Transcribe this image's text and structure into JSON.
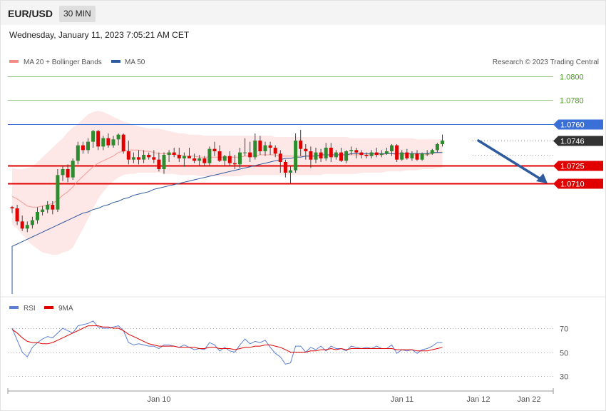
{
  "header": {
    "symbol": "EUR/USD",
    "timeframe": "30 MIN",
    "datetime": "Wednesday, January 11, 2023 7:05:21 AM CET"
  },
  "legend_main": [
    {
      "name": "MA 20 + Bollinger Bands",
      "color": "#f28b82"
    },
    {
      "name": "MA 50",
      "color": "#2e5a9e"
    }
  ],
  "credit": "Research © 2023 Trading Central",
  "legend_rsi": [
    {
      "name": "RSI",
      "color": "#5b7fd6"
    },
    {
      "name": "9MA",
      "color": "#e00000"
    }
  ],
  "colors": {
    "bull": "#2e8b2e",
    "bear": "#e00000",
    "resistance": "#3a6fd8",
    "support": "#e00000",
    "target": "#93c47d",
    "last": "#333333",
    "arrow": "#2e5a9e"
  },
  "chart_data": [
    {
      "type": "candlestick",
      "title": "EUR/USD",
      "ylim": [
        1.0665,
        1.0812
      ],
      "x_labels": [
        "Jan 10",
        "Jan 11",
        "Jan 12",
        "Jan 22"
      ],
      "price_levels": [
        {
          "value": 1.08,
          "label": "1.0800",
          "kind": "target"
        },
        {
          "value": 1.078,
          "label": "1.0780",
          "kind": "target"
        },
        {
          "value": 1.076,
          "label": "1.0760",
          "kind": "resistance"
        },
        {
          "value": 1.0746,
          "label": "1.0746",
          "kind": "last"
        },
        {
          "value": 1.0725,
          "label": "1.0725",
          "kind": "support"
        },
        {
          "value": 1.071,
          "label": "1.0710",
          "kind": "support"
        }
      ],
      "forecast_arrow": {
        "from": 1.0746,
        "to": 1.071
      },
      "candles": [
        [
          1.069,
          1.0691,
          1.0685,
          1.0689
        ],
        [
          1.0689,
          1.0692,
          1.0675,
          1.0678
        ],
        [
          1.0678,
          1.0683,
          1.067,
          1.0672
        ],
        [
          1.0672,
          1.0678,
          1.0669,
          1.0675
        ],
        [
          1.0675,
          1.0682,
          1.0672,
          1.0679
        ],
        [
          1.0679,
          1.069,
          1.0676,
          1.0686
        ],
        [
          1.0686,
          1.0691,
          1.0683,
          1.0688
        ],
        [
          1.0688,
          1.0695,
          1.0685,
          1.0692
        ],
        [
          1.0692,
          1.0695,
          1.0684,
          1.0688
        ],
        [
          1.0688,
          1.0722,
          1.0686,
          1.0717
        ],
        [
          1.0717,
          1.0725,
          1.0712,
          1.0722
        ],
        [
          1.0722,
          1.0726,
          1.0711,
          1.0715
        ],
        [
          1.0715,
          1.0731,
          1.0713,
          1.0729
        ],
        [
          1.0729,
          1.0745,
          1.0726,
          1.0742
        ],
        [
          1.0742,
          1.0745,
          1.0735,
          1.0738
        ],
        [
          1.0738,
          1.0748,
          1.0735,
          1.0745
        ],
        [
          1.0745,
          1.0755,
          1.074,
          1.0754
        ],
        [
          1.0754,
          1.0755,
          1.0738,
          1.0741
        ],
        [
          1.0741,
          1.075,
          1.0738,
          1.0748
        ],
        [
          1.0748,
          1.0752,
          1.074,
          1.0742
        ],
        [
          1.0742,
          1.075,
          1.074,
          1.0747
        ],
        [
          1.0747,
          1.0752,
          1.0742,
          1.0751
        ],
        [
          1.0751,
          1.0752,
          1.0735,
          1.0737
        ],
        [
          1.0737,
          1.0746,
          1.0726,
          1.073
        ],
        [
          1.073,
          1.0736,
          1.0727,
          1.0732
        ],
        [
          1.0732,
          1.0738,
          1.0726,
          1.073
        ],
        [
          1.073,
          1.0738,
          1.0727,
          1.0734
        ],
        [
          1.0734,
          1.0736,
          1.073,
          1.0732
        ],
        [
          1.0732,
          1.0738,
          1.0727,
          1.073
        ],
        [
          1.073,
          1.0736,
          1.072,
          1.0722
        ],
        [
          1.0722,
          1.0736,
          1.0718,
          1.0734
        ],
        [
          1.0734,
          1.0738,
          1.0728,
          1.0736
        ],
        [
          1.0736,
          1.074,
          1.0732,
          1.0734
        ],
        [
          1.0734,
          1.074,
          1.0728,
          1.0731
        ],
        [
          1.0731,
          1.0736,
          1.0724,
          1.0733
        ],
        [
          1.0733,
          1.074,
          1.0731,
          1.0731
        ],
        [
          1.0731,
          1.0735,
          1.0727,
          1.0729
        ],
        [
          1.0729,
          1.0734,
          1.0725,
          1.0731
        ],
        [
          1.0731,
          1.0733,
          1.0725,
          1.0727
        ],
        [
          1.0727,
          1.0741,
          1.0725,
          1.0739
        ],
        [
          1.0739,
          1.0745,
          1.0733,
          1.0737
        ],
        [
          1.0737,
          1.0742,
          1.0728,
          1.0729
        ],
        [
          1.0729,
          1.0734,
          1.0725,
          1.0733
        ],
        [
          1.0733,
          1.0737,
          1.0725,
          1.0727
        ],
        [
          1.0727,
          1.0734,
          1.0722,
          1.0726
        ],
        [
          1.0726,
          1.074,
          1.0723,
          1.0736
        ],
        [
          1.0736,
          1.0748,
          1.0733,
          1.0736
        ],
        [
          1.0736,
          1.0745,
          1.0728,
          1.0732
        ],
        [
          1.0732,
          1.0752,
          1.073,
          1.0746
        ],
        [
          1.0746,
          1.075,
          1.0734,
          1.0737
        ],
        [
          1.0737,
          1.0745,
          1.0733,
          1.0742
        ],
        [
          1.0742,
          1.0745,
          1.0734,
          1.074
        ],
        [
          1.074,
          1.0742,
          1.0732,
          1.0735
        ],
        [
          1.0735,
          1.0738,
          1.0719,
          1.0728
        ],
        [
          1.0728,
          1.073,
          1.0715,
          1.0719
        ],
        [
          1.0719,
          1.0725,
          1.071,
          1.0721
        ],
        [
          1.0721,
          1.0752,
          1.0719,
          1.0746
        ],
        [
          1.0746,
          1.0755,
          1.0733,
          1.0739
        ],
        [
          1.0739,
          1.0743,
          1.073,
          1.0737
        ],
        [
          1.0737,
          1.0741,
          1.0723,
          1.073
        ],
        [
          1.073,
          1.074,
          1.0727,
          1.0736
        ],
        [
          1.0736,
          1.0739,
          1.0728,
          1.0731
        ],
        [
          1.0731,
          1.0744,
          1.0729,
          1.074
        ],
        [
          1.074,
          1.0744,
          1.0728,
          1.0732
        ],
        [
          1.0732,
          1.0738,
          1.073,
          1.0736
        ],
        [
          1.0736,
          1.074,
          1.0728,
          1.0729
        ],
        [
          1.0729,
          1.0738,
          1.0727,
          1.0737
        ],
        [
          1.0737,
          1.0741,
          1.0734,
          1.0738
        ],
        [
          1.0738,
          1.074,
          1.0731,
          1.0736
        ],
        [
          1.0736,
          1.0738,
          1.0731,
          1.0734
        ],
        [
          1.0734,
          1.0736,
          1.0731,
          1.0733
        ],
        [
          1.0733,
          1.0738,
          1.0731,
          1.0736
        ],
        [
          1.0736,
          1.074,
          1.0732,
          1.0734
        ],
        [
          1.0734,
          1.0738,
          1.0732,
          1.0735
        ],
        [
          1.0735,
          1.074,
          1.0734,
          1.0737
        ],
        [
          1.0737,
          1.0743,
          1.0733,
          1.0742
        ],
        [
          1.0742,
          1.0743,
          1.0728,
          1.073
        ],
        [
          1.073,
          1.0738,
          1.0729,
          1.0736
        ],
        [
          1.0736,
          1.0739,
          1.073,
          1.0731
        ],
        [
          1.0731,
          1.0737,
          1.0729,
          1.0735
        ],
        [
          1.0735,
          1.0738,
          1.0729,
          1.073
        ],
        [
          1.073,
          1.0736,
          1.0729,
          1.0735
        ],
        [
          1.0735,
          1.0738,
          1.0733,
          1.0735
        ],
        [
          1.0735,
          1.0739,
          1.0734,
          1.0738
        ],
        [
          1.0738,
          1.0744,
          1.0736,
          1.0743
        ],
        [
          1.0743,
          1.0751,
          1.0741,
          1.0746
        ]
      ],
      "ma20": [
        1.0699,
        1.0697,
        1.0694,
        1.0691,
        1.069,
        1.069,
        1.0691,
        1.0692,
        1.0693,
        1.0696,
        1.07,
        1.0703,
        1.0707,
        1.0712,
        1.0716,
        1.072,
        1.0724,
        1.0727,
        1.0729,
        1.0731,
        1.0733,
        1.0736,
        1.0737,
        1.0738,
        1.0738,
        1.0738,
        1.0737,
        1.0737,
        1.0736,
        1.0735,
        1.0735,
        1.0735,
        1.0734,
        1.0734,
        1.0733,
        1.0733,
        1.0733,
        1.0732,
        1.0732,
        1.0732,
        1.0732,
        1.0732,
        1.0732,
        1.0732,
        1.0732,
        1.0732,
        1.0733,
        1.0733,
        1.0733,
        1.0734,
        1.0734,
        1.0734,
        1.0734,
        1.0733,
        1.0733,
        1.0733,
        1.0733,
        1.0733,
        1.0733,
        1.0733,
        1.0733,
        1.0734,
        1.0734,
        1.0734,
        1.0734,
        1.0734,
        1.0734,
        1.0734,
        1.0734,
        1.0734,
        1.0734,
        1.0734,
        1.0734,
        1.0734,
        1.0735,
        1.0735,
        1.0734,
        1.0734,
        1.0734,
        1.0734,
        1.0734,
        1.0734,
        1.0734,
        1.0735,
        1.0736,
        1.0736
      ],
      "bb_upper": [
        1.0723,
        1.0722,
        1.0722,
        1.0723,
        1.0724,
        1.0728,
        1.0732,
        1.0736,
        1.074,
        1.0744,
        1.0748,
        1.0753,
        1.0757,
        1.076,
        1.0764,
        1.0768,
        1.077,
        1.0771,
        1.077,
        1.0768,
        1.0766,
        1.0764,
        1.0762,
        1.0761,
        1.0759,
        1.0758,
        1.0757,
        1.0756,
        1.0756,
        1.0756,
        1.0755,
        1.0754,
        1.0753,
        1.0752,
        1.0752,
        1.0751,
        1.0751,
        1.0751,
        1.075,
        1.075,
        1.075,
        1.075,
        1.075,
        1.075,
        1.075,
        1.075,
        1.075,
        1.075,
        1.075,
        1.075,
        1.075,
        1.075,
        1.0749,
        1.0749,
        1.0749,
        1.0749,
        1.0749,
        1.0749,
        1.0749,
        1.0749,
        1.0749,
        1.0749,
        1.0749,
        1.0749,
        1.0749,
        1.0749,
        1.0749,
        1.0748,
        1.0748,
        1.0748,
        1.0748,
        1.0748,
        1.0748,
        1.0748,
        1.0748,
        1.0748,
        1.0748,
        1.0748,
        1.0748,
        1.0748,
        1.0747,
        1.0747,
        1.0747,
        1.0747,
        1.0747,
        1.0747
      ],
      "bb_lower": [
        1.0675,
        1.0672,
        1.0667,
        1.0662,
        1.0658,
        1.0655,
        1.0652,
        1.0651,
        1.065,
        1.065,
        1.0652,
        1.0653,
        1.0656,
        1.0664,
        1.0672,
        1.068,
        1.0689,
        1.0697,
        1.0703,
        1.0708,
        1.0712,
        1.0715,
        1.0717,
        1.0718,
        1.0718,
        1.0719,
        1.0719,
        1.0719,
        1.0719,
        1.0719,
        1.0718,
        1.0718,
        1.0718,
        1.0717,
        1.0717,
        1.0717,
        1.0717,
        1.0716,
        1.0716,
        1.0716,
        1.0716,
        1.0716,
        1.0716,
        1.0716,
        1.0716,
        1.0716,
        1.0717,
        1.0717,
        1.0717,
        1.0717,
        1.0717,
        1.0717,
        1.0717,
        1.0717,
        1.0717,
        1.0717,
        1.0717,
        1.0717,
        1.0717,
        1.0717,
        1.0717,
        1.0717,
        1.0718,
        1.0718,
        1.0718,
        1.0718,
        1.0718,
        1.0718,
        1.0718,
        1.0719,
        1.0719,
        1.0719,
        1.0719,
        1.0719,
        1.072,
        1.072,
        1.072,
        1.072,
        1.0721,
        1.0721,
        1.0721,
        1.0722,
        1.0722,
        1.0722,
        1.0723,
        1.0723
      ],
      "ma50": [
        1.0657,
        1.0659,
        1.0661,
        1.0663,
        1.0665,
        1.0667,
        1.0669,
        1.0671,
        1.0673,
        1.0675,
        1.0677,
        1.0679,
        1.0681,
        1.0683,
        1.0685,
        1.0686,
        1.0688,
        1.0689,
        1.0691,
        1.0692,
        1.0694,
        1.0695,
        1.0697,
        1.0698,
        1.07,
        1.0701,
        1.0702,
        1.0703,
        1.0705,
        1.0706,
        1.0707,
        1.0708,
        1.0709,
        1.071,
        1.0711,
        1.0712,
        1.0713,
        1.0714,
        1.0715,
        1.0716,
        1.0717,
        1.0718,
        1.0719,
        1.072,
        1.0721,
        1.0722,
        1.0723,
        1.0724,
        1.0725,
        1.0726,
        1.0727,
        1.0728,
        1.0729,
        1.073,
        1.0731,
        1.0731,
        1.0732,
        1.0732,
        1.0733,
        1.0733,
        1.0733,
        1.0734,
        1.0734,
        1.0734,
        1.0734,
        1.0734,
        1.0734,
        1.0735,
        1.0735,
        1.0735,
        1.0735,
        1.0735,
        1.0735,
        1.0735,
        1.0735,
        1.0735,
        1.0735,
        1.0735,
        1.0735,
        1.0735,
        1.0735,
        1.0735,
        1.0735,
        1.0736,
        1.0736,
        1.0736
      ]
    },
    {
      "type": "line",
      "title": "RSI",
      "ylim": [
        20,
        80
      ],
      "y_ticks": [
        30,
        50,
        70
      ],
      "series": [
        {
          "name": "RSI",
          "values": [
            70,
            60,
            50,
            46,
            54,
            58,
            61,
            63,
            62,
            66,
            70,
            68,
            66,
            72,
            73,
            74,
            76,
            71,
            70,
            70,
            71,
            72,
            68,
            58,
            56,
            57,
            56,
            55,
            55,
            53,
            56,
            56,
            55,
            54,
            56,
            54,
            52,
            53,
            52,
            58,
            56,
            51,
            54,
            51,
            50,
            56,
            61,
            57,
            59,
            58,
            60,
            54,
            49,
            46,
            40,
            41,
            55,
            55,
            50,
            54,
            52,
            55,
            51,
            55,
            53,
            53,
            51,
            55,
            54,
            53,
            54,
            53,
            55,
            53,
            53,
            56,
            49,
            52,
            51,
            52,
            49,
            52,
            53,
            55,
            58,
            58
          ]
        },
        {
          "name": "9MA",
          "values": [
            69,
            66,
            62,
            59,
            58,
            58,
            57,
            57,
            58,
            60,
            62,
            64,
            66,
            68,
            70,
            72,
            72,
            72,
            71,
            71,
            70,
            70,
            68,
            65,
            63,
            61,
            59,
            57,
            56,
            55,
            55,
            55,
            55,
            54,
            54,
            54,
            54,
            53,
            53,
            54,
            54,
            53,
            53,
            53,
            52,
            53,
            54,
            54,
            55,
            55,
            56,
            56,
            55,
            54,
            52,
            50,
            50,
            50,
            50,
            51,
            51,
            52,
            52,
            53,
            52,
            53,
            52,
            53,
            53,
            53,
            53,
            53,
            53,
            53,
            53,
            53,
            52,
            52,
            52,
            52,
            51,
            51,
            51,
            52,
            53,
            54
          ]
        }
      ]
    }
  ]
}
